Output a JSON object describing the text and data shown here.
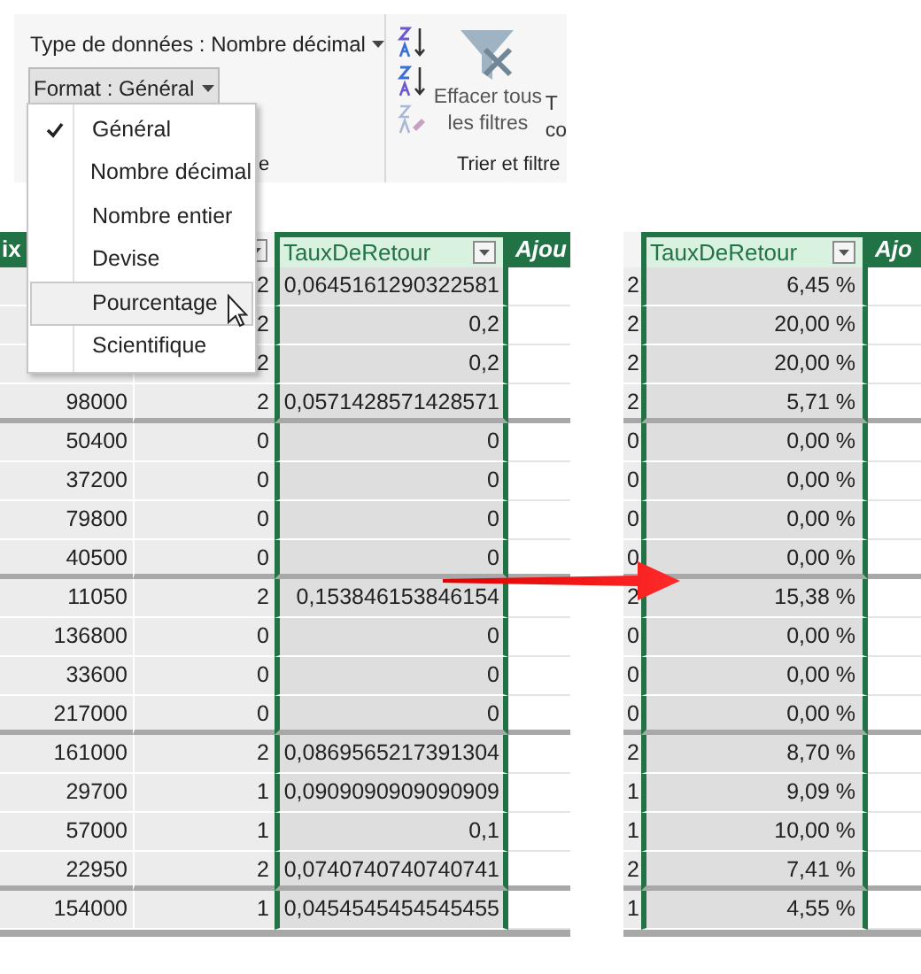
{
  "ribbon": {
    "data_type_button": "Type de données : Nombre décimal",
    "format_button": "Format : Général",
    "group_label": "e",
    "sort_group": {
      "clear_filters_button": "Effacer tous les filtres",
      "cut_button_lines": [
        "T",
        "co"
      ],
      "label": "Trier et filtre"
    }
  },
  "format_menu": {
    "items": [
      {
        "label": "Général",
        "checked": true,
        "highlighted": false
      },
      {
        "label": "Nombre décimal",
        "checked": false,
        "highlighted": false
      },
      {
        "label": "Nombre entier",
        "checked": false,
        "highlighted": false
      },
      {
        "label": "Devise",
        "checked": false,
        "highlighted": false
      },
      {
        "label": "Pourcentage",
        "checked": false,
        "highlighted": true
      },
      {
        "label": "Scientifique",
        "checked": false,
        "highlighted": false
      }
    ]
  },
  "table_before": {
    "column_1_header": "ix",
    "column_3_header": "TauxDeRetour",
    "column_4_header": "Ajou",
    "rows": [
      {
        "column_2": "2",
        "column_3": "0,0645161290322581"
      },
      {
        "column_2": "2",
        "column_3": "0,2"
      },
      {
        "column_2": "2",
        "column_3": "0,2"
      },
      {
        "column_1": "98000",
        "column_2": "2",
        "column_3": "0,0571428571428571"
      },
      {
        "column_1": "50400",
        "column_2": "0",
        "column_3": "0"
      },
      {
        "column_1": "37200",
        "column_2": "0",
        "column_3": "0"
      },
      {
        "column_1": "79800",
        "column_2": "0",
        "column_3": "0"
      },
      {
        "column_1": "40500",
        "column_2": "0",
        "column_3": "0"
      },
      {
        "column_1": "11050",
        "column_2": "2",
        "column_3": "0,153846153846154"
      },
      {
        "column_1": "136800",
        "column_2": "0",
        "column_3": "0"
      },
      {
        "column_1": "33600",
        "column_2": "0",
        "column_3": "0"
      },
      {
        "column_1": "217000",
        "column_2": "0",
        "column_3": "0"
      },
      {
        "column_1": "161000",
        "column_2": "2",
        "column_3": "0,0869565217391304"
      },
      {
        "column_1": "29700",
        "column_2": "1",
        "column_3": "0,0909090909090909"
      },
      {
        "column_1": "57000",
        "column_2": "1",
        "column_3": "0,1"
      },
      {
        "column_1": "22950",
        "column_2": "2",
        "column_3": "0,0740740740740741"
      },
      {
        "column_1": "154000",
        "column_2": "1",
        "column_3": "0,0454545454545455"
      }
    ]
  },
  "table_after": {
    "column_3_header": "TauxDeRetour",
    "column_4_header": "Ajo",
    "rows": [
      {
        "column_2": "2",
        "column_3": "6,45 %"
      },
      {
        "column_2": "2",
        "column_3": "20,00 %"
      },
      {
        "column_2": "2",
        "column_3": "20,00 %"
      },
      {
        "column_2": "2",
        "column_3": "5,71 %"
      },
      {
        "column_2": "0",
        "column_3": "0,00 %"
      },
      {
        "column_2": "0",
        "column_3": "0,00 %"
      },
      {
        "column_2": "0",
        "column_3": "0,00 %"
      },
      {
        "column_2": "0",
        "column_3": "0,00 %"
      },
      {
        "column_2": "2",
        "column_3": "15,38 %"
      },
      {
        "column_2": "0",
        "column_3": "0,00 %"
      },
      {
        "column_2": "0",
        "column_3": "0,00 %"
      },
      {
        "column_2": "0",
        "column_3": "0,00 %"
      },
      {
        "column_2": "2",
        "column_3": "8,70 %"
      },
      {
        "column_2": "1",
        "column_3": "9,09 %"
      },
      {
        "column_2": "1",
        "column_3": "10,00 %"
      },
      {
        "column_2": "2",
        "column_3": "7,41 %"
      },
      {
        "column_2": "1",
        "column_3": "4,55 %"
      }
    ]
  }
}
